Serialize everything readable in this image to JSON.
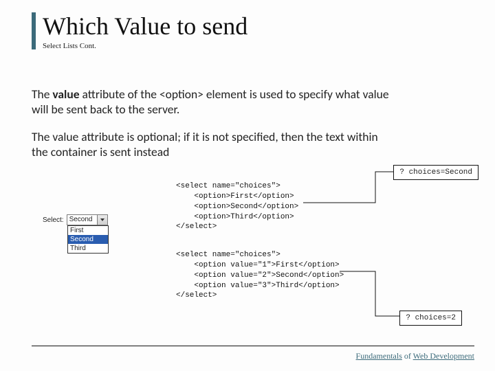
{
  "title": "Which Value to send",
  "subtitle": "Select Lists Cont.",
  "para1_prefix": "The ",
  "para1_bold": "value",
  "para1_mid": " attribute of the ",
  "para1_tag": "<option>",
  "para1_suffix": " element is used to specify what value will be sent back to the server.",
  "para2": "The value attribute is optional; if it is not specified, then the text within the container is sent instead",
  "select_label": "Select:",
  "select_shown": "Second",
  "options": {
    "o1": "First",
    "o2": "Second",
    "o3": "Third"
  },
  "code1": "<select name=\"choices\">\n    <option>First</option>\n    <option>Second</option>\n    <option>Third</option>\n</select>",
  "code2": "<select name=\"choices\">\n    <option value=\"1\">First</option>\n    <option value=\"2\">Second</option>\n    <option value=\"3\">Third</option>\n</select>",
  "result1": "? choices=Second",
  "result2": "? choices=2",
  "footer_a": "Fundamentals",
  "footer_b": " of ",
  "footer_c": "Web Development"
}
